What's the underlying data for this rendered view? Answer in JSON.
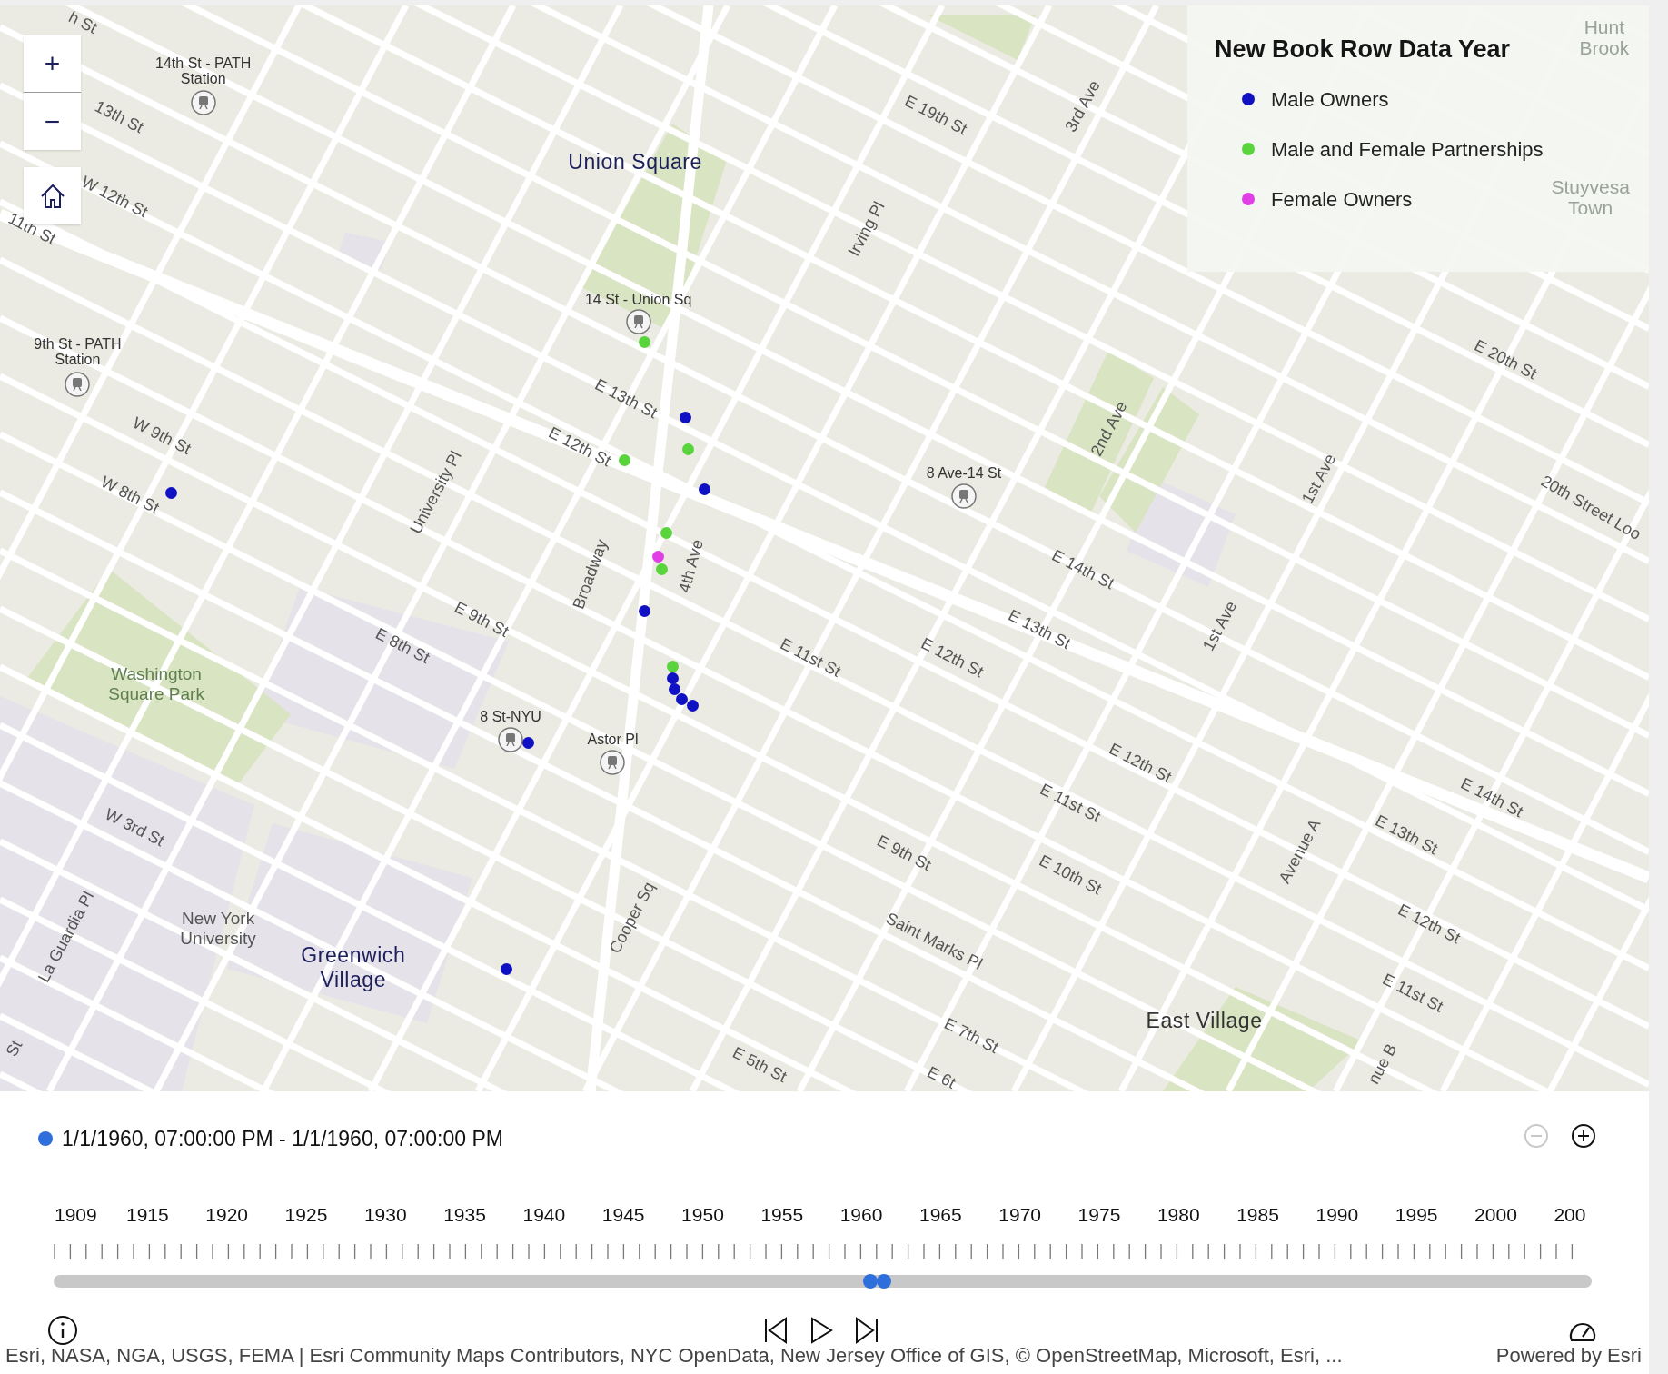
{
  "map": {
    "zoom_in": "+",
    "zoom_out": "−",
    "labels": [
      {
        "text": "h St",
        "kind": "street"
      },
      {
        "text": "14th St - PATH\nStation",
        "kind": "station"
      },
      {
        "text": "13th St",
        "kind": "street"
      },
      {
        "text": "W 12th St",
        "kind": "street"
      },
      {
        "text": "11th St",
        "kind": "street"
      },
      {
        "text": "Union Square",
        "kind": "place"
      },
      {
        "text": "14 St - Union Sq",
        "kind": "station"
      },
      {
        "text": "9th St - PATH\nStation",
        "kind": "station"
      },
      {
        "text": "E 13th St",
        "kind": "street"
      },
      {
        "text": "E 12th St",
        "kind": "street"
      },
      {
        "text": "W 9th St",
        "kind": "street"
      },
      {
        "text": "W 8th St",
        "kind": "street"
      },
      {
        "text": "University Pl",
        "kind": "avenue"
      },
      {
        "text": "Broadway",
        "kind": "avenue"
      },
      {
        "text": "4th Ave",
        "kind": "avenue"
      },
      {
        "text": "E 19th St",
        "kind": "street"
      },
      {
        "text": "3rd Ave",
        "kind": "avenue"
      },
      {
        "text": "Irving Pl",
        "kind": "avenue"
      },
      {
        "text": "2nd Ave",
        "kind": "avenue"
      },
      {
        "text": "8 Ave-14 St",
        "kind": "station"
      },
      {
        "text": "1st Ave",
        "kind": "avenue"
      },
      {
        "text": "E 20th St",
        "kind": "street"
      },
      {
        "text": "20th Street Loo",
        "kind": "street"
      },
      {
        "text": "E 14th St",
        "kind": "street"
      },
      {
        "text": "E 13th St",
        "kind": "street"
      },
      {
        "text": "1st Ave",
        "kind": "avenue"
      },
      {
        "text": "E 12th St",
        "kind": "street"
      },
      {
        "text": "E 11st St",
        "kind": "street"
      },
      {
        "text": "E 9th St",
        "kind": "street"
      },
      {
        "text": "E 8th St",
        "kind": "street"
      },
      {
        "text": "Washington\nSquare Park",
        "kind": "park"
      },
      {
        "text": "8 St-NYU",
        "kind": "station"
      },
      {
        "text": "Astor Pl",
        "kind": "station"
      },
      {
        "text": "E 12th St",
        "kind": "street"
      },
      {
        "text": "E 11st St",
        "kind": "street"
      },
      {
        "text": "E 14th St",
        "kind": "street"
      },
      {
        "text": "E 13th St",
        "kind": "street"
      },
      {
        "text": "Avenue A",
        "kind": "avenue"
      },
      {
        "text": "W 3rd St",
        "kind": "street"
      },
      {
        "text": "E 9th St",
        "kind": "street"
      },
      {
        "text": "E 10th St",
        "kind": "street"
      },
      {
        "text": "La Guardia Pl",
        "kind": "avenue"
      },
      {
        "text": "New York\nUniversity",
        "kind": "campus"
      },
      {
        "text": "Greenwich\nVillage",
        "kind": "place"
      },
      {
        "text": "Cooper Sq",
        "kind": "avenue"
      },
      {
        "text": "Saint Marks Pl",
        "kind": "street"
      },
      {
        "text": "E 12th St",
        "kind": "street"
      },
      {
        "text": "E 11st St",
        "kind": "street"
      },
      {
        "text": "East Village",
        "kind": "district"
      },
      {
        "text": "E 7th St",
        "kind": "street"
      },
      {
        "text": "E 5th St",
        "kind": "street"
      },
      {
        "text": "E 6t",
        "kind": "street"
      },
      {
        "text": "nue B",
        "kind": "avenue"
      },
      {
        "text": "St",
        "kind": "street"
      },
      {
        "text": "Hunt\nBrook",
        "kind": "faded"
      },
      {
        "text": "Stuyvesa\nTown",
        "kind": "faded"
      }
    ],
    "points": [
      {
        "color": "#5ad43c"
      },
      {
        "color": "#1111c4"
      },
      {
        "color": "#5ad43c"
      },
      {
        "color": "#5ad43c"
      },
      {
        "color": "#1111c4"
      },
      {
        "color": "#1111c4"
      },
      {
        "color": "#5ad43c"
      },
      {
        "color": "#5ad43c"
      },
      {
        "color": "#e23ee6"
      },
      {
        "color": "#1111c4"
      },
      {
        "color": "#5ad43c"
      },
      {
        "color": "#1111c4"
      },
      {
        "color": "#1111c4"
      },
      {
        "color": "#1111c4"
      },
      {
        "color": "#1111c4"
      },
      {
        "color": "#1111c4"
      },
      {
        "color": "#1111c4"
      }
    ]
  },
  "legend": {
    "title": "New Book Row Data Year",
    "items": [
      {
        "label": "Male Owners",
        "color": "#1111c4"
      },
      {
        "label": "Male and Female Partnerships",
        "color": "#5ad43c"
      },
      {
        "label": "Female Owners",
        "color": "#e23ee6"
      }
    ]
  },
  "time_slider": {
    "range": "1/1/1960, 07:00:00 PM - 1/1/1960, 07:00:00 PM",
    "zoom_out_disabled": true,
    "zoom_in_disabled": false,
    "years": [
      "1909",
      "1915",
      "1920",
      "1925",
      "1930",
      "1935",
      "1940",
      "1945",
      "1950",
      "1955",
      "1960",
      "1965",
      "1970",
      "1975",
      "1980",
      "1985",
      "1990",
      "1995",
      "2000",
      "200"
    ],
    "thumbs": [
      {
        "level": 0.531
      },
      {
        "level": 0.54
      }
    ]
  },
  "attribution": "Esri, NASA, NGA, USGS, FEMA | Esri Community Maps Contributors, NYC OpenData, New Jersey Office of GIS, © OpenStreetMap, Microsoft, Esri, ...",
  "powered_by": "Powered by Esri"
}
